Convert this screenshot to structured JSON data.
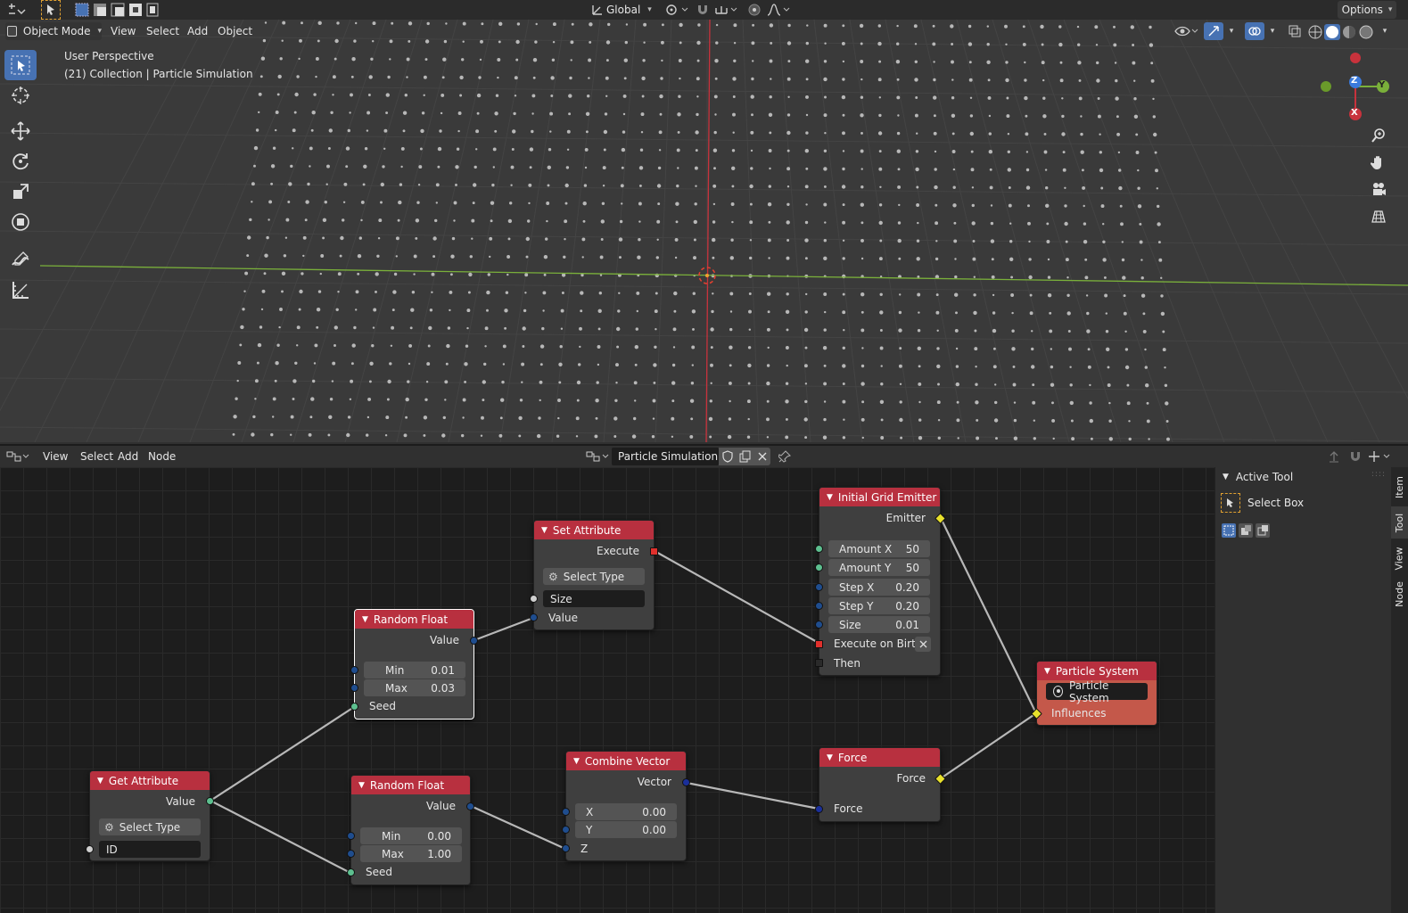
{
  "topbar": {
    "transform_orientation": "Global",
    "options_label": "Options"
  },
  "viewport_header": {
    "mode": "Object Mode",
    "menus": [
      "View",
      "Select",
      "Add",
      "Object"
    ]
  },
  "viewport": {
    "perspective_label": "User Perspective",
    "collection_label": "(21) Collection | Particle Simulation",
    "gizmo": {
      "x": "X",
      "y": "Y",
      "z": "Z"
    }
  },
  "node_header": {
    "menus": [
      "View",
      "Select",
      "Add",
      "Node"
    ],
    "tree_name": "Particle Simulation"
  },
  "sidebar": {
    "panel_title": "Active Tool",
    "tool_name": "Select Box",
    "tabs": [
      "Item",
      "Tool",
      "View",
      "Node"
    ]
  },
  "nodes": {
    "set_attribute": {
      "title": "Set Attribute",
      "out_execute": "Execute",
      "select_type": "Select Type",
      "size_field": "Size",
      "in_value": "Value"
    },
    "random_float_1": {
      "title": "Random Float",
      "out_value": "Value",
      "min_label": "Min",
      "min_value": "0.01",
      "max_label": "Max",
      "max_value": "0.03",
      "seed": "Seed"
    },
    "random_float_2": {
      "title": "Random Float",
      "out_value": "Value",
      "min_label": "Min",
      "min_value": "0.00",
      "max_label": "Max",
      "max_value": "1.00",
      "seed": "Seed"
    },
    "get_attribute": {
      "title": "Get Attribute",
      "out_value": "Value",
      "select_type": "Select Type",
      "id_field": "ID"
    },
    "initial_grid_emitter": {
      "title": "Initial Grid Emitter",
      "out_emitter": "Emitter",
      "amount_x_label": "Amount X",
      "amount_x": "50",
      "amount_y_label": "Amount Y",
      "amount_y": "50",
      "step_x_label": "Step X",
      "step_x": "0.20",
      "step_y_label": "Step Y",
      "step_y": "0.20",
      "size_label": "Size",
      "size": "0.01",
      "execute_on_birth": "Execute on Birth",
      "then": "Then"
    },
    "combine_vector": {
      "title": "Combine Vector",
      "out_vector": "Vector",
      "x_label": "X",
      "x_value": "0.00",
      "y_label": "Y",
      "y_value": "0.00",
      "z_label": "Z"
    },
    "force": {
      "title": "Force",
      "out_force": "Force",
      "in_force": "Force"
    },
    "particle_system": {
      "title": "Particle System",
      "object_field": "Particle System",
      "in_influences": "Influences"
    }
  },
  "colors": {
    "node_header": "#b8303f",
    "particle_system_body": "#c4584a",
    "active_blue": "#4772b3",
    "x_axis": "#c8323c",
    "y_axis": "#7ab03a"
  }
}
